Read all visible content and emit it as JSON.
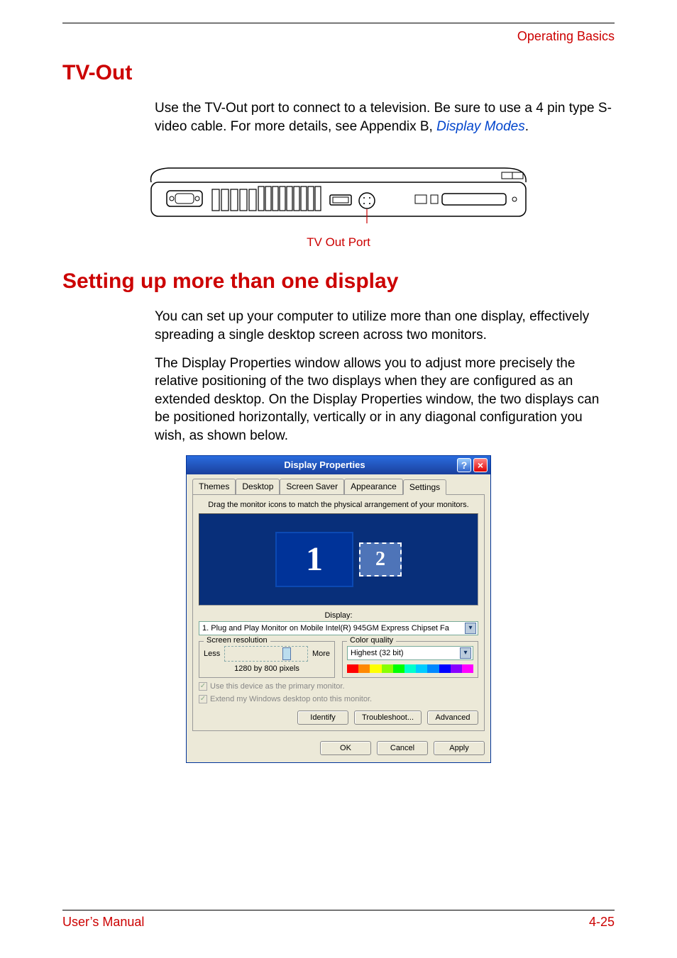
{
  "header": {
    "section": "Operating Basics"
  },
  "sections": {
    "tvout": {
      "heading": "TV-Out",
      "para_a": "Use the TV-Out port to connect to a television. Be sure to use a 4 pin type S-video cable. For more details, see Appendix B, ",
      "link": "Display Modes",
      "para_end": ".",
      "caption": "TV Out Port"
    },
    "multidisplay": {
      "heading": "Setting up more than one display",
      "para1": "You can set up your computer to utilize more than one display, effectively spreading a single desktop screen across two monitors.",
      "para2": "The Display Properties window allows you to adjust more precisely the relative positioning of the two displays when they are configured as an extended desktop. On the Display Properties window, the two displays can be positioned horizontally, vertically or in any diagonal configuration you wish, as shown below."
    }
  },
  "dialog": {
    "title": "Display Properties",
    "tabs": [
      "Themes",
      "Desktop",
      "Screen Saver",
      "Appearance",
      "Settings"
    ],
    "active_tab_index": 4,
    "drag_text": "Drag the monitor icons to match the physical arrangement of your monitors.",
    "monitor_labels": [
      "1",
      "2"
    ],
    "display_label": "Display:",
    "display_value": "1. Plug and Play Monitor on Mobile Intel(R) 945GM Express Chipset Fa",
    "screen_res_group": "Screen resolution",
    "less": "Less",
    "more": "More",
    "resolution": "1280 by 800 pixels",
    "color_group": "Color quality",
    "color_value": "Highest (32 bit)",
    "check_primary": "Use this device as the primary monitor.",
    "check_extend": "Extend my Windows desktop onto this monitor.",
    "identify_btn": "Identify",
    "troubleshoot_btn": "Troubleshoot...",
    "advanced_btn": "Advanced",
    "ok_btn": "OK",
    "cancel_btn": "Cancel",
    "apply_btn": "Apply"
  },
  "footer": {
    "left": "User’s Manual",
    "right": "4-25"
  }
}
